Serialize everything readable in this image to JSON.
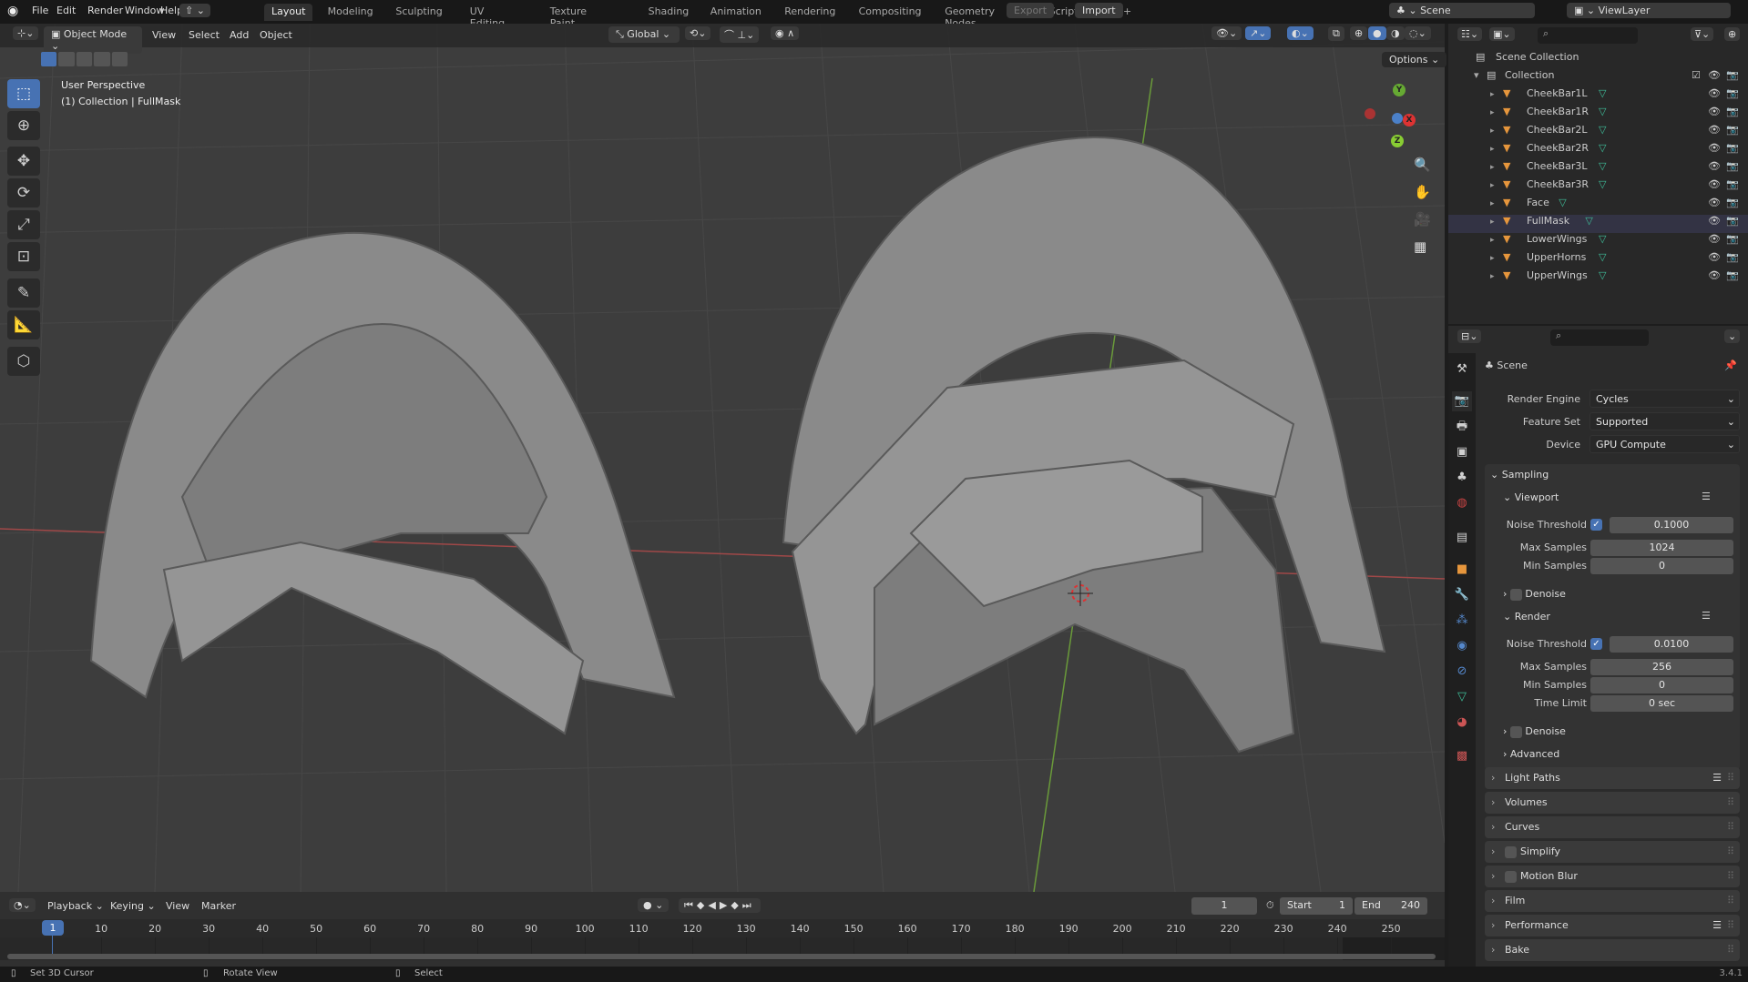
{
  "topbar": {
    "menus": [
      "File",
      "Edit",
      "Render",
      "Window",
      "Help"
    ],
    "workspaces": [
      "Layout",
      "Modeling",
      "Sculpting",
      "UV Editing",
      "Texture Paint",
      "Shading",
      "Animation",
      "Rendering",
      "Compositing",
      "Geometry Nodes",
      "Scripting"
    ],
    "add_workspace": "+",
    "export": "Export",
    "import": "Import",
    "scene": "Scene",
    "view_layer": "ViewLayer"
  },
  "viewport": {
    "mode": "Object Mode",
    "menus": [
      "View",
      "Select",
      "Add",
      "Object"
    ],
    "orientation": "Global",
    "options": "Options",
    "overlay_line1": "User Perspective",
    "overlay_line2": "(1) Collection | FullMask",
    "gizmo": {
      "x": "X",
      "y": "Y",
      "z": "Z"
    }
  },
  "outliner": {
    "root": "Scene Collection",
    "collection": "Collection",
    "items": [
      "CheekBar1L",
      "CheekBar1R",
      "CheekBar2L",
      "CheekBar2R",
      "CheekBar3L",
      "CheekBar3R",
      "Face",
      "FullMask",
      "LowerWings",
      "UpperHorns",
      "UpperWings"
    ],
    "active": "FullMask"
  },
  "properties": {
    "context": "Scene",
    "render_engine_label": "Render Engine",
    "render_engine": "Cycles",
    "feature_set_label": "Feature Set",
    "feature_set": "Supported",
    "device_label": "Device",
    "device": "GPU Compute",
    "sampling": "Sampling",
    "viewport": "Viewport",
    "noise_threshold_label": "Noise Threshold",
    "vp_noise": "0.1000",
    "max_samples_label": "Max Samples",
    "vp_max": "1024",
    "min_samples_label": "Min Samples",
    "vp_min": "0",
    "denoise": "Denoise",
    "render": "Render",
    "r_noise": "0.0100",
    "r_max": "256",
    "r_min": "0",
    "time_limit_label": "Time Limit",
    "r_time": "0 sec",
    "advanced": "Advanced",
    "panels": [
      "Light Paths",
      "Volumes",
      "Curves",
      "Simplify",
      "Motion Blur",
      "Film",
      "Performance",
      "Bake"
    ]
  },
  "timeline": {
    "menus": [
      "Playback",
      "Keying",
      "View",
      "Marker"
    ],
    "current_frame": "1",
    "start_label": "Start",
    "start": "1",
    "end_label": "End",
    "end": "240",
    "ticks": [
      "10",
      "20",
      "30",
      "40",
      "50",
      "60",
      "70",
      "80",
      "90",
      "100",
      "110",
      "120",
      "130",
      "140",
      "150",
      "160",
      "170",
      "180",
      "190",
      "200",
      "210",
      "220",
      "230",
      "240",
      "250"
    ]
  },
  "status": {
    "hint1": "Set 3D Cursor",
    "hint2": "Rotate View",
    "hint3": "Select",
    "version": "3.4.1"
  },
  "colors": {
    "accent": "#4772b3",
    "object": "#e6963c",
    "mesh": "#3fbf9a"
  }
}
